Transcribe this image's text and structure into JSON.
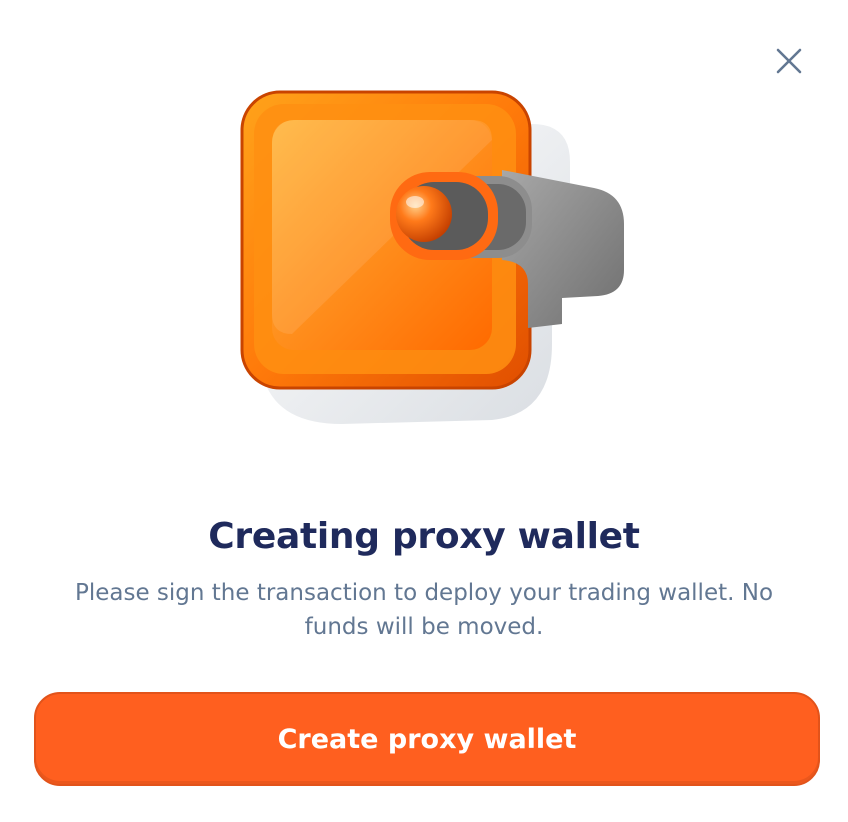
{
  "dialog": {
    "title": "Creating proxy wallet",
    "description": "Please sign the transaction to deploy your trading wallet. No funds will be moved.",
    "primary_button_label": "Create proxy wallet",
    "close_icon": "close-icon",
    "illustration": "wallet-switch-illustration"
  },
  "colors": {
    "accent": "#ff5f1f",
    "title": "#1f2a5c",
    "description": "#627792",
    "close_icon": "#627792"
  }
}
